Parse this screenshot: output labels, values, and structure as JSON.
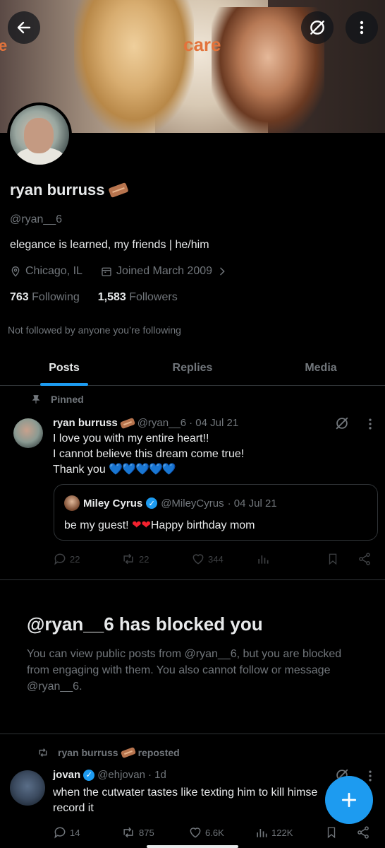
{
  "banner": {
    "care_text": "care",
    "care_partial": "e"
  },
  "profile": {
    "name": "ryan burruss",
    "handle": "@ryan__6",
    "bio": "elegance is learned, my friends | he/him",
    "location": "Chicago, IL",
    "joined": "Joined March 2009",
    "following_count": "763",
    "following_label": "Following",
    "followers_count": "1,583",
    "followers_label": "Followers",
    "not_followed": "Not followed by anyone you’re following"
  },
  "tabs": [
    {
      "label": "Posts",
      "active": true
    },
    {
      "label": "Replies",
      "active": false
    },
    {
      "label": "Media",
      "active": false
    }
  ],
  "pinned_post": {
    "pinned_label": "Pinned",
    "author": "ryan burruss",
    "handle": "@ryan__6",
    "date": "· 04 Jul 21",
    "lines": [
      "I love you with my entire heart!!",
      "I cannot believe this dream come true!",
      "Thank you"
    ],
    "blue_hearts": "💙💙💙💙💙",
    "quote": {
      "author": "Miley Cyrus",
      "handle": "@MileyCyrus",
      "date": "· 04 Jul 21",
      "text_before": "be my guest!",
      "red_hearts": "❤❤",
      "text_after": "Happy birthday mom"
    },
    "stats": {
      "replies": "22",
      "reposts": "22",
      "likes": "344"
    }
  },
  "blocked": {
    "title": "@ryan__6 has blocked you",
    "body": "You can view public posts from @ryan__6, but you are blocked from engaging with them. You also cannot follow or message @ryan__6."
  },
  "repost": {
    "label": "ryan burruss",
    "suffix": "reposted",
    "author": "jovan",
    "handle": "@ehjovan",
    "date": "· 1d",
    "lines": [
      "when the cutwater tastes like texting him to kill himse",
      "record it"
    ],
    "stats": {
      "replies": "14",
      "reposts": "875",
      "likes": "6.6K",
      "views": "122K"
    }
  },
  "colors": {
    "accent": "#1d9bf0",
    "muted": "#71767b",
    "text": "#e7e9ea",
    "background": "#000000",
    "border": "#2f3336"
  }
}
